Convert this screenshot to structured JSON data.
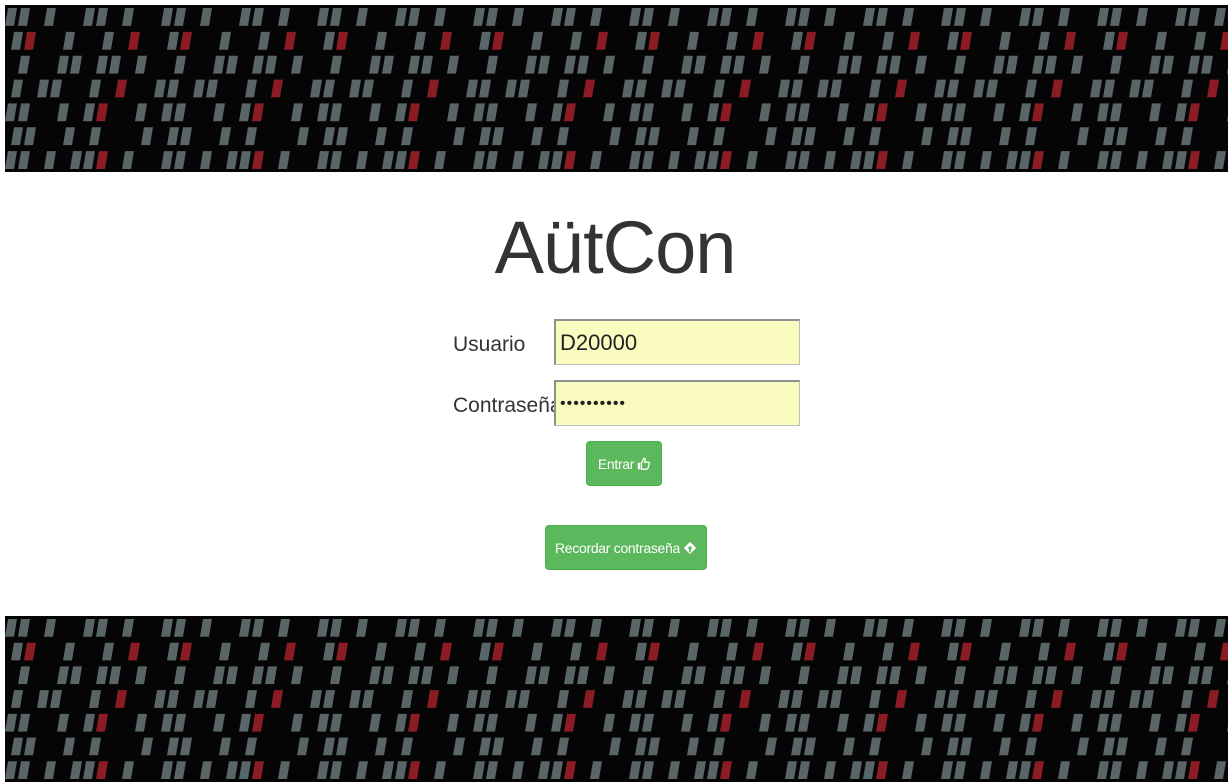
{
  "app": {
    "title": "AütCon"
  },
  "login_form": {
    "username_label": "Usuario",
    "username_value": "D20000",
    "password_label": "Contraseña",
    "password_value": "••••••••••",
    "submit_label": "Entrar",
    "submit_icon": "thumbs-up-icon",
    "remember_label": "Recordar contraseña",
    "remember_icon": "puzzle-icon"
  },
  "colors": {
    "button_green": "#5cb85c",
    "input_background": "#fafcbf",
    "banner_background": "#050505",
    "banner_tile_gray": "#5a6567",
    "banner_tile_red": "#8b1c24"
  }
}
